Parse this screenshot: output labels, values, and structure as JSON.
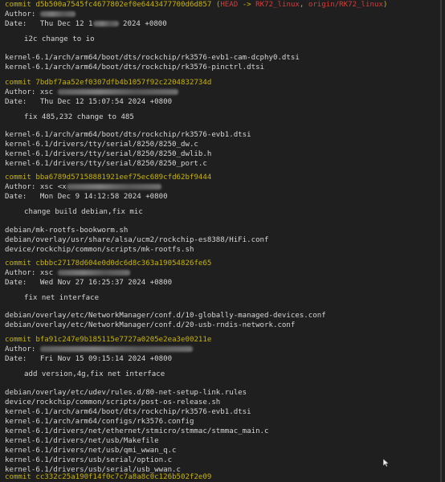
{
  "commits": [
    {
      "commit_label": "commit",
      "hash": "d5b500a7545fc4677802ef0e6443477700d6d857",
      "refs": {
        "open": "(",
        "head": "HEAD",
        "arrow": "->",
        "branch": "RK72_linux",
        "sep": ",",
        "remote": "origin/RK72_linux",
        "close": ")"
      },
      "author_label": "Author:",
      "author_name": "",
      "date_label": "Date:",
      "date_prefix": "Thu Dec 12 1",
      "date_suffix": "2024 +0800",
      "message": "i2c change to io",
      "files": [
        "kernel-6.1/arch/arm64/boot/dts/rockchip/rk3576-evb1-cam-dcphy0.dtsi",
        "kernel-6.1/arch/arm64/boot/dts/rockchip/rk3576-pinctrl.dtsi"
      ]
    },
    {
      "commit_label": "commit",
      "hash": "7bdbf7aa52ef0307dfb4b1057f92c2204832734d",
      "author_label": "Author:",
      "author_name": "xsc",
      "date_label": "Date:",
      "date": "Thu Dec 12 15:07:54 2024 +0800",
      "message": "fix 485,232 change to 485",
      "files": [
        "kernel-6.1/arch/arm64/boot/dts/rockchip/rk3576-evb1.dtsi",
        "kernel-6.1/drivers/tty/serial/8250/8250_dw.c",
        "kernel-6.1/drivers/tty/serial/8250/8250_dwlib.h",
        "kernel-6.1/drivers/tty/serial/8250/8250_port.c"
      ]
    },
    {
      "commit_label": "commit",
      "hash": "bba6789d57158881921eef75ec689cfd62bf9444",
      "author_label": "Author:",
      "author_name": "xsc <x",
      "date_label": "Date:",
      "date": "Mon Dec 9 14:12:58 2024 +0800",
      "message": "change build debian,fix mic",
      "files": [
        "debian/mk-rootfs-bookworm.sh",
        "debian/overlay/usr/share/alsa/ucm2/rockchip-es8388/HiFi.conf",
        "device/rockchip/common/scripts/mk-rootfs.sh"
      ]
    },
    {
      "commit_label": "commit",
      "hash": "cbbbc27178d604e0d0dc6d8c363a19054826fe65",
      "author_label": "Author:",
      "author_name": "xsc",
      "date_label": "Date:",
      "date": "Wed Nov 27 16:25:37 2024 +0800",
      "message": "fix net interface",
      "files": [
        "debian/overlay/etc/NetworkManager/conf.d/10-globally-managed-devices.conf",
        "debian/overlay/etc/NetworkManager/conf.d/20-usb-rndis-network.conf"
      ]
    },
    {
      "commit_label": "commit",
      "hash": "bfa91c247e9b185115e7727a0205e2ea3e00211e",
      "author_label": "Author:",
      "author_name": "",
      "date_label": "Date:",
      "date": "Fri Nov 15 09:15:14 2024 +0800",
      "message": "add version,4g,fix net interface",
      "files": [
        "debian/overlay/etc/udev/rules.d/80-net-setup-link.rules",
        "device/rockchip/common/scripts/post-os-release.sh",
        "kernel-6.1/arch/arm64/boot/dts/rockchip/rk3576-evb1.dtsi",
        "kernel-6.1/arch/arm64/configs/rk3576.config",
        "kernel-6.1/drivers/net/ethernet/stmicro/stmmac/stmmac_main.c",
        "kernel-6.1/drivers/net/usb/Makefile",
        "kernel-6.1/drivers/net/usb/qmi_wwan_q.c",
        "kernel-6.1/drivers/usb/serial/option.c",
        "kernel-6.1/drivers/usb/serial/usb_wwan.c"
      ]
    },
    {
      "commit_label": "commit",
      "hash": "cc332c25a190f14f0c7c7a8a8c0c126b502f2e09"
    }
  ],
  "colors": {
    "background": "#1f1f1f",
    "text": "#d6d6d6",
    "commit": "#c9b400",
    "branch": "#d43c3c"
  }
}
